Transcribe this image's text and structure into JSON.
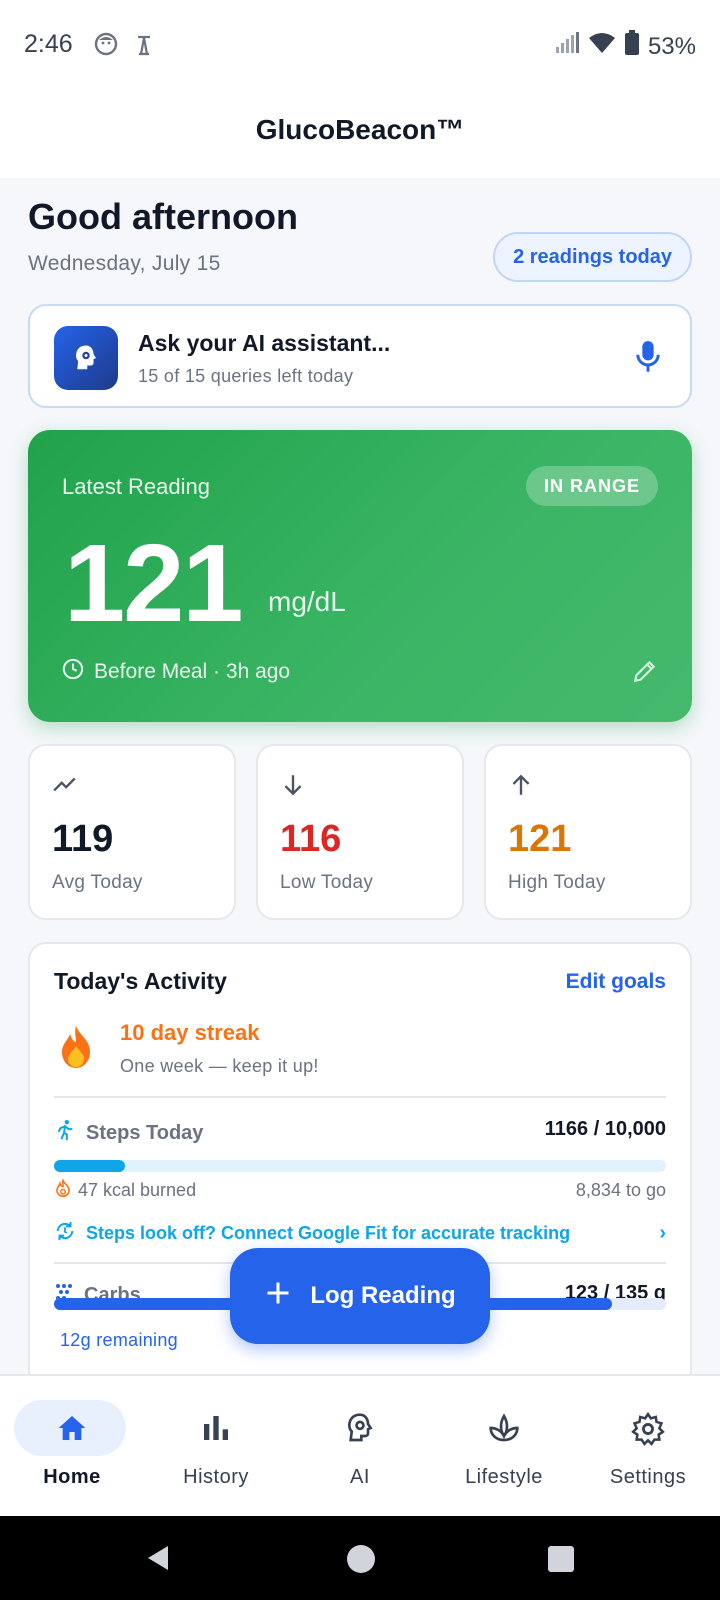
{
  "status_bar": {
    "time": "2:46",
    "battery": "53%"
  },
  "app": {
    "title": "GlucoBeacon™"
  },
  "header": {
    "greeting": "Good afternoon",
    "date": "Wednesday, July 15",
    "readings_badge": "2 readings today"
  },
  "ai_assistant": {
    "title": "Ask your AI assistant...",
    "subtitle": "15 of 15 queries left today"
  },
  "latest_reading": {
    "label": "Latest Reading",
    "status": "IN RANGE",
    "value": "121",
    "unit": "mg/dL",
    "context": "Before Meal · 3h ago"
  },
  "stats": [
    {
      "value": "119",
      "label": "Avg Today",
      "color": "#111827",
      "icon": "trend-icon"
    },
    {
      "value": "116",
      "label": "Low Today",
      "color": "#dc2626",
      "icon": "arrow-down-icon"
    },
    {
      "value": "121",
      "label": "High Today",
      "color": "#d97706",
      "icon": "arrow-up-icon"
    }
  ],
  "activity": {
    "title": "Today's Activity",
    "edit_label": "Edit goals",
    "streak_title": "10 day streak",
    "streak_subtitle": "One week — keep it up!",
    "steps_label": "Steps Today",
    "steps_value": "1166 / 10,000",
    "steps_fraction": 0.1166,
    "kcal": "47 kcal burned",
    "to_go": "8,834 to go",
    "fit_link": "Steps look off? Connect Google Fit for accurate tracking",
    "carbs_label": "Carbs",
    "carbs_value": "123 / 135 g",
    "carbs_fraction": 0.911,
    "carbs_remaining": "12g remaining"
  },
  "fab": {
    "label": "Log Reading"
  },
  "nav": {
    "items": [
      {
        "label": "Home",
        "icon": "home-icon",
        "active": true
      },
      {
        "label": "History",
        "icon": "bar-chart-icon",
        "active": false
      },
      {
        "label": "AI",
        "icon": "ai-head-icon",
        "active": false
      },
      {
        "label": "Lifestyle",
        "icon": "plant-icon",
        "active": false
      },
      {
        "label": "Settings",
        "icon": "gear-icon",
        "active": false
      }
    ]
  },
  "colors": {
    "primary": "#2563eb",
    "in_range_green": "#22a34c",
    "steps_blue": "#0ea5e9",
    "streak_orange": "#f97316"
  }
}
